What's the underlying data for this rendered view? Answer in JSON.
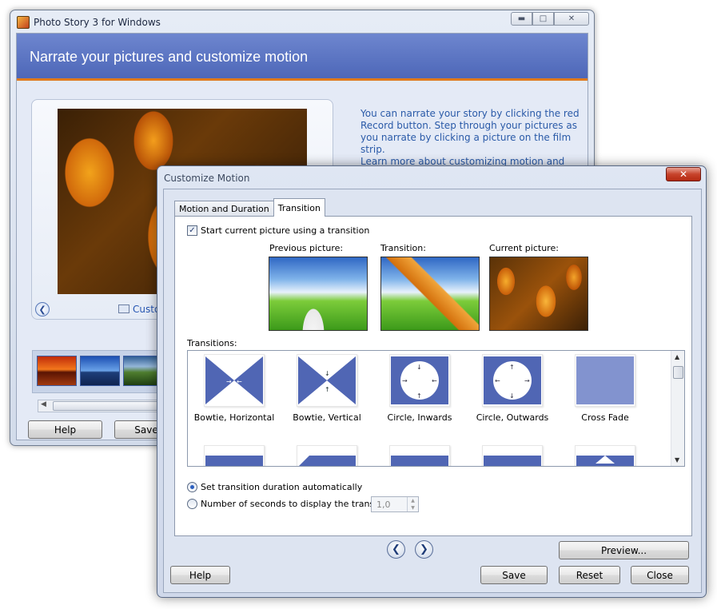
{
  "main_window": {
    "title": "Photo Story 3 for Windows",
    "banner": "Narrate your pictures and customize motion",
    "help_text": "You can narrate your story by clicking the red Record button. Step through your pictures as you narrate by clicking a picture on the film strip.",
    "help_link": "Learn more about customizing motion and selecting transitions",
    "customize_link": "Custom",
    "buttons": {
      "help": "Help",
      "save": "Save"
    },
    "caption_buttons": {
      "minimize": "▬",
      "maximize": "□",
      "close": "✕"
    }
  },
  "dialog": {
    "title": "Customize Motion",
    "close": "✕",
    "tabs": [
      {
        "label": "Motion and Duration"
      },
      {
        "label": "Transition"
      }
    ],
    "checkbox_label": "Start current picture using a transition",
    "preview_labels": {
      "previous": "Previous picture:",
      "transition": "Transition:",
      "current": "Current picture:"
    },
    "transitions_label": "Transitions:",
    "transitions": [
      {
        "name": "Bowtie, Horizontal",
        "icon": "bowtie-horizontal"
      },
      {
        "name": "Bowtie, Vertical",
        "icon": "bowtie-vertical"
      },
      {
        "name": "Circle, Inwards",
        "icon": "circle-inwards"
      },
      {
        "name": "Circle, Outwards",
        "icon": "circle-outwards"
      },
      {
        "name": "Cross Fade",
        "icon": "cross-fade"
      }
    ],
    "radio_auto": "Set transition duration automatically",
    "radio_manual": "Number of seconds to display the transition",
    "seconds_value": "1,0",
    "buttons": {
      "preview": "Preview...",
      "help": "Help",
      "save": "Save",
      "reset": "Reset",
      "close": "Close"
    },
    "nav": {
      "prev": "❮",
      "next": "❯"
    },
    "accent_color": "#4d67b8"
  }
}
